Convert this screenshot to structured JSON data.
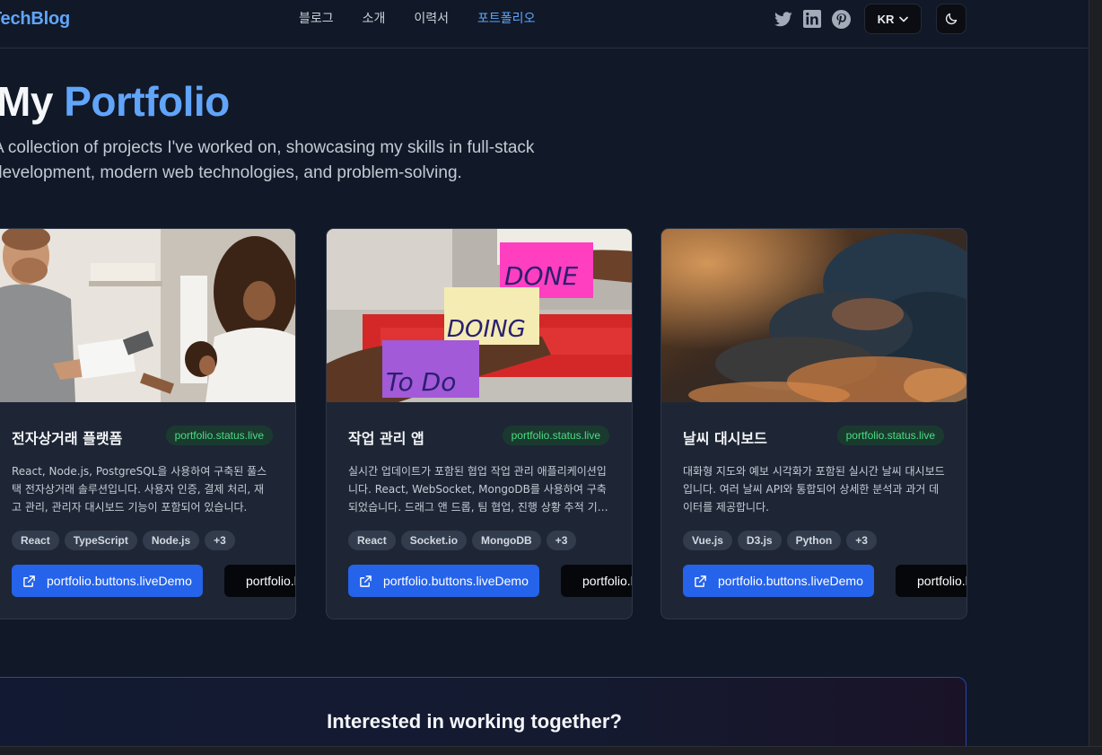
{
  "header": {
    "brand": "TechBlog",
    "nav": [
      {
        "label": "블로그",
        "active": false
      },
      {
        "label": "소개",
        "active": false
      },
      {
        "label": "이력서",
        "active": false
      },
      {
        "label": "포트폴리오",
        "active": true
      }
    ],
    "social_icons": [
      "twitter-icon",
      "linkedin-icon",
      "pinterest-icon"
    ],
    "language": "KR",
    "theme_icon": "moon-icon"
  },
  "hero": {
    "title_plain": "My",
    "title_accent": "Portfolio",
    "subtitle": "A collection of projects I've worked on, showcasing my skills in full-stack development, modern web technologies, and problem-solving."
  },
  "projects": [
    {
      "title": "전자상거래 플랫폼",
      "status": "portfolio.status.live",
      "description": "React, Node.js, PostgreSQL을 사용하여 구축된 풀스택 전자상거래 솔루션입니다. 사용자 인증, 결제 처리, 재고 관리, 관리자 대시보드 기능이 포함되어 있습니다.",
      "tags": [
        "React",
        "TypeScript",
        "Node.js",
        "+3"
      ],
      "live_label": "portfolio.buttons.liveDemo",
      "code_label": "portfolio.buttons.code"
    },
    {
      "title": "작업 관리 앱",
      "status": "portfolio.status.live",
      "description": "실시간 업데이트가 포함된 협업 작업 관리 애플리케이션입니다. React, WebSocket, MongoDB를 사용하여 구축되었습니다. 드래그 앤 드롭, 팀 협업, 진행 상황 추적 기능을 제공합니다.",
      "tags": [
        "React",
        "Socket.io",
        "MongoDB",
        "+3"
      ],
      "live_label": "portfolio.buttons.liveDemo",
      "code_label": "portfolio.buttons.code"
    },
    {
      "title": "날씨 대시보드",
      "status": "portfolio.status.live",
      "description": "대화형 지도와 예보 시각화가 포함된 실시간 날씨 대시보드입니다. 여러 날씨 API와 통합되어 상세한 분석과 과거 데이터를 제공합니다.",
      "tags": [
        "Vue.js",
        "D3.js",
        "Python",
        "+3"
      ],
      "live_label": "portfolio.buttons.liveDemo",
      "code_label": "portfolio.buttons.code"
    }
  ],
  "cta": {
    "title": "Interested in working together?"
  },
  "colors": {
    "accent": "#60a5fa",
    "primary_button": "#2563eb",
    "status_text": "#4ade80",
    "background": "#111827",
    "card": "#1e2635"
  }
}
